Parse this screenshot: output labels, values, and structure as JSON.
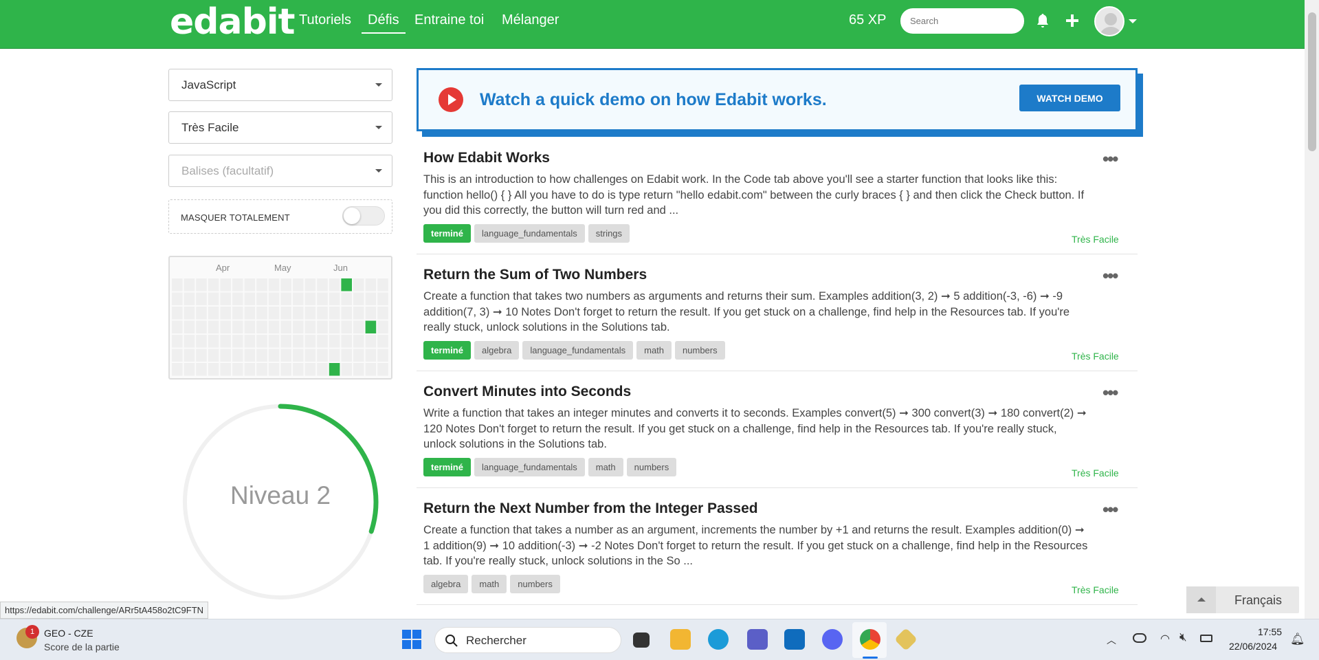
{
  "header": {
    "logo": "edabit",
    "nav": [
      "Tutoriels",
      "Défis",
      "Entraine toi",
      "Mélanger"
    ],
    "active_nav": "Défis",
    "xp": "65 XP",
    "search_placeholder": "Search"
  },
  "filters": {
    "language": "JavaScript",
    "difficulty": "Très Facile",
    "tags_placeholder": "Balises (facultatif)",
    "hide_label": "MASQUER TOTALEMENT"
  },
  "heatmap": {
    "months": [
      "Apr",
      "May",
      "Jun"
    ]
  },
  "level": {
    "label": "Niveau 2",
    "progress": 0.3
  },
  "demo": {
    "text": "Watch a quick demo on how Edabit works.",
    "button": "WATCH DEMO"
  },
  "challenges": [
    {
      "title": "How Edabit Works",
      "desc": "This is an introduction to how challenges on Edabit work. In the Code tab above you'll see a starter function that looks like this: function hello() { } All you have to do is type return \"hello edabit.com\" between the curly braces { } and then click the Check button. If you did this correctly, the button will turn red and ...",
      "tags": [
        "terminé",
        "language_fundamentals",
        "strings"
      ],
      "done": true,
      "level": "Très Facile"
    },
    {
      "title": "Return the Sum of Two Numbers",
      "desc": "Create a function that takes two numbers as arguments and returns their sum. Examples addition(3, 2) ➞ 5 addition(-3, -6) ➞ -9 addition(7, 3) ➞ 10 Notes Don't forget to return the result. If you get stuck on a challenge, find help in the Resources tab. If you're really stuck, unlock solutions in the Solutions tab.",
      "tags": [
        "terminé",
        "algebra",
        "language_fundamentals",
        "math",
        "numbers"
      ],
      "done": true,
      "level": "Très Facile"
    },
    {
      "title": "Convert Minutes into Seconds",
      "desc": "Write a function that takes an integer minutes and converts it to seconds. Examples convert(5) ➞ 300 convert(3) ➞ 180 convert(2) ➞ 120 Notes Don't forget to return the result. If you get stuck on a challenge, find help in the Resources tab. If you're really stuck, unlock solutions in the Solutions tab.",
      "tags": [
        "terminé",
        "language_fundamentals",
        "math",
        "numbers"
      ],
      "done": true,
      "level": "Très Facile"
    },
    {
      "title": "Return the Next Number from the Integer Passed",
      "desc": "Create a function that takes a number as an argument, increments the number by +1 and returns the result. Examples addition(0) ➞ 1 addition(9) ➞ 10 addition(-3) ➞ -2 Notes Don't forget to return the result. If you get stuck on a challenge, find help in the Resources tab. If you're really stuck, unlock solutions in the So ...",
      "tags": [
        "algebra",
        "math",
        "numbers"
      ],
      "done": false,
      "level": "Très Facile"
    }
  ],
  "language_switch": "Français",
  "status_url": "https://edabit.com/challenge/ARr5tA458o2tC9FTN",
  "taskbar": {
    "widget_title": "GEO - CZE",
    "widget_sub": "Score de la partie",
    "widget_badge": "1",
    "search": "Rechercher",
    "time": "17:55",
    "date": "22/06/2024"
  },
  "colors": {
    "brand": "#2fb44a",
    "demo": "#1d7bc9"
  }
}
